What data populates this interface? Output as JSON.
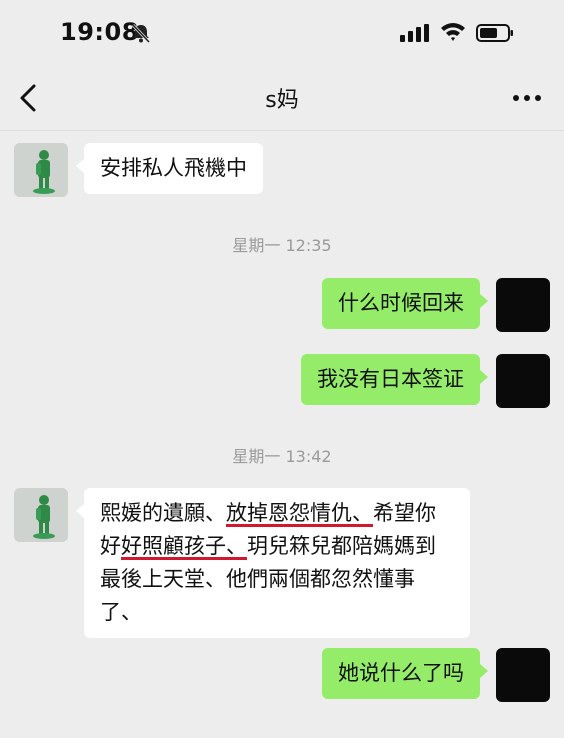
{
  "status_bar": {
    "time": "19:08"
  },
  "header": {
    "title": "s妈"
  },
  "messages": [
    {
      "side": "left",
      "text": "安排私人飛機中"
    },
    {
      "type": "time",
      "text": "星期一 12:35"
    },
    {
      "side": "right",
      "text": "什么时候回来"
    },
    {
      "side": "right",
      "text": "我没有日本签证"
    },
    {
      "type": "time",
      "text": "星期一 13:42"
    },
    {
      "side": "left",
      "lines": {
        "l1a": "熙媛的遺願、",
        "l1b": "放掉恩怨情仇、",
        "l1c": "希望你",
        "l2a": "好",
        "l2b": "好照顧孩子、",
        "l2c": "玥兒箖兒都陪媽媽到",
        "l3": "最後上天堂、他們兩個都忽然懂事",
        "l4": "了、"
      }
    },
    {
      "side": "right",
      "text": "她说什么了吗"
    }
  ],
  "colors": {
    "background": "#ededed",
    "sent_bubble": "#95ec69",
    "received_bubble": "#ffffff",
    "underline": "#d0192e"
  }
}
